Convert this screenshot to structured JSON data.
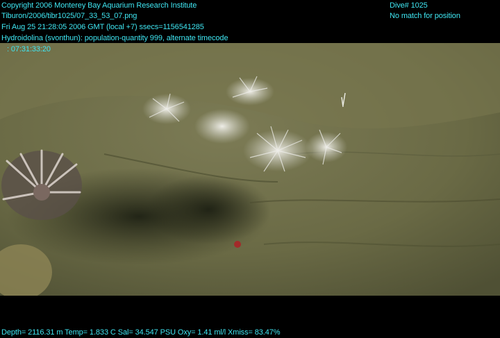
{
  "overlay": {
    "copyright": "Copyright 2006 Monterey Bay Aquarium Research Institute",
    "image_path": "Tiburon/2006/tibr1025/07_33_53_07.png",
    "datetime": "Fri Aug 25 21:28:05 2006 GMT (local +7)  ssecs=1156541285",
    "annotation": "Hydroidolina (svonthun): population-quantity 999, alternate timecode",
    "timecode": ": 07:31:33:20",
    "dive": "Dive# 1025",
    "position": "No match for position",
    "sensors": "Depth= 2116.31 m  Temp= 1.833 C  Sal= 34.547 PSU  Oxy= 1.41 ml/l  Xmiss= 83.47%"
  },
  "colors": {
    "overlay_text": "#3fe6f2",
    "background": "#000000",
    "seafloor": "#6e6d48"
  }
}
